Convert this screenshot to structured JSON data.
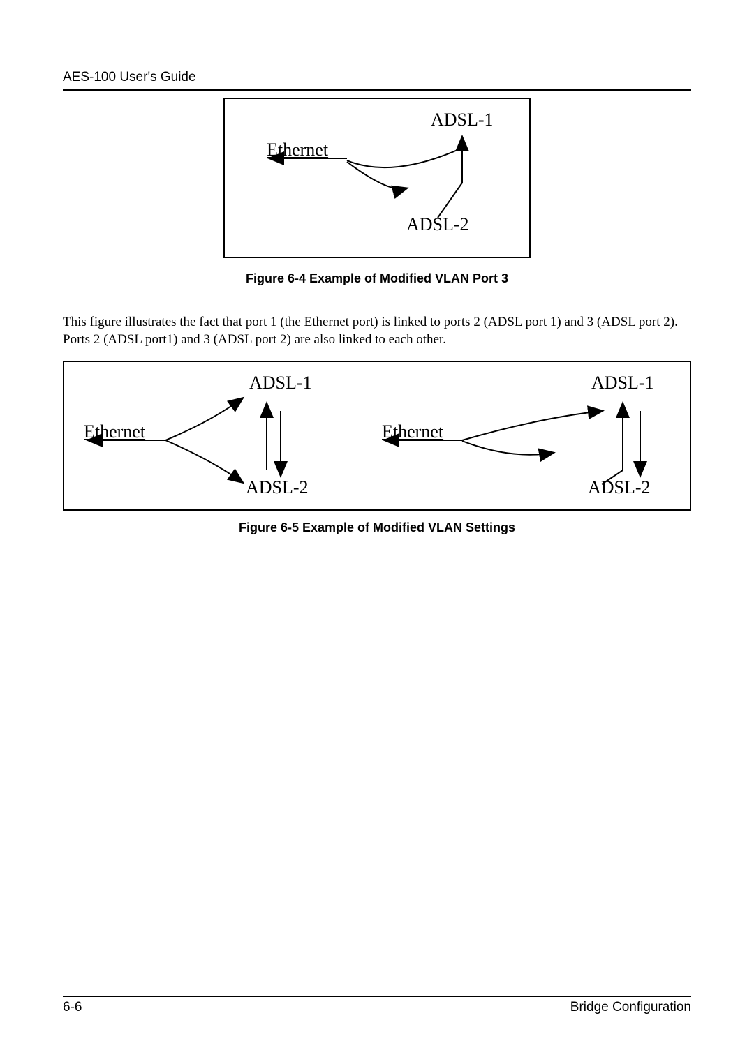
{
  "header": "AES-100 User's Guide",
  "figure1": {
    "caption": "Figure 6-4 Example of Modified VLAN Port 3",
    "labels": {
      "ethernet": "Ethernet",
      "adsl1": "ADSL-1",
      "adsl2": "ADSL-2"
    }
  },
  "paragraph": "This figure illustrates the fact that port 1 (the Ethernet port) is linked to ports 2 (ADSL port 1) and 3 (ADSL port 2). Ports 2 (ADSL port1) and 3 (ADSL port 2) are also linked to each other.",
  "figure2": {
    "caption": "Figure 6-5 Example of Modified VLAN Settings",
    "left": {
      "ethernet": "Ethernet",
      "adsl1": "ADSL-1",
      "adsl2": "ADSL-2"
    },
    "right": {
      "ethernet": "Ethernet",
      "adsl1": "ADSL-1",
      "adsl2": "ADSL-2"
    }
  },
  "footer": {
    "page": "6-6",
    "section": "Bridge Configuration"
  }
}
